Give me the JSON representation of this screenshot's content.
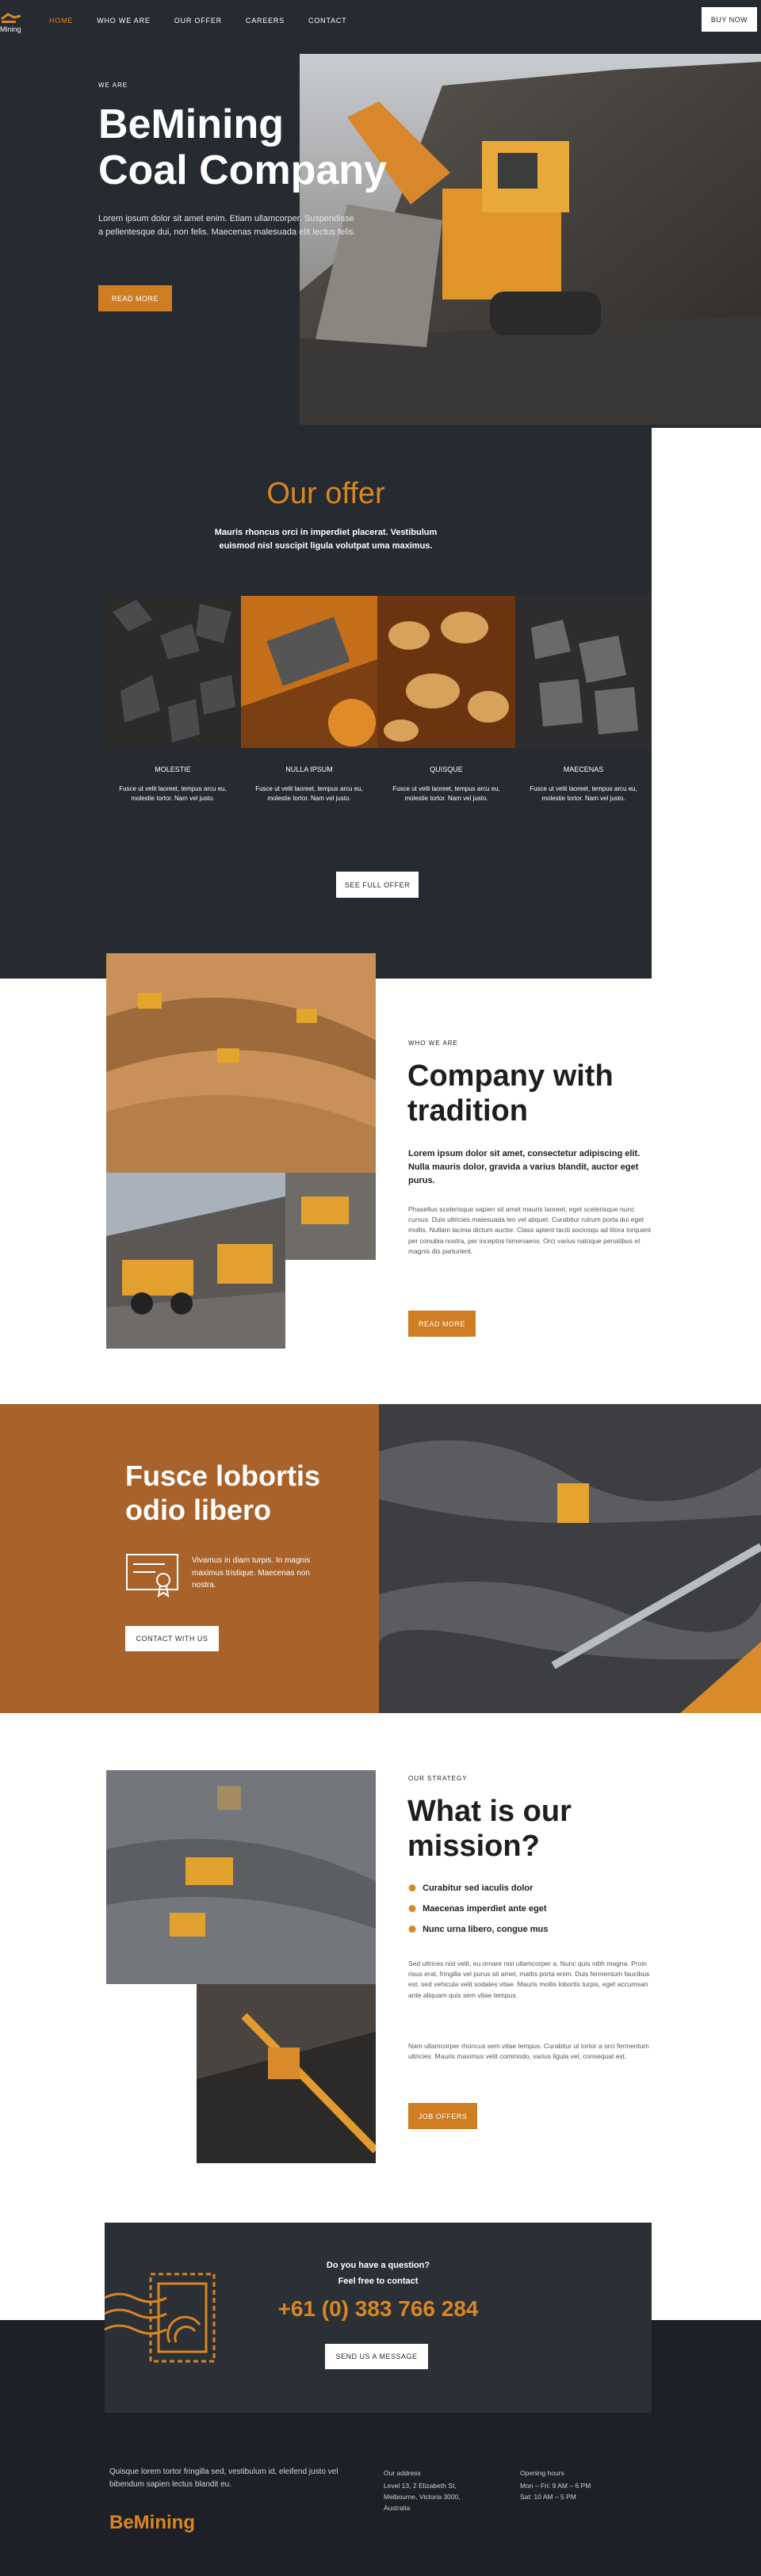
{
  "header": {
    "logo_text": "Mining",
    "nav": [
      "Home",
      "Who we are",
      "Our offer",
      "Careers",
      "Contact"
    ],
    "buy_now": "Buy now"
  },
  "hero": {
    "eyebrow": "We are",
    "title_line1": "BeMining",
    "title_line2": "Coal Company",
    "text": "Lorem ipsum dolor sit amet enim. Etiam ullamcorper. Suspendisse a pellentesque dui, non felis. Maecenas malesuada elit lectus felis.",
    "button": "Read more"
  },
  "offer": {
    "title": "Our offer",
    "subtitle": "Mauris rhoncus orci in imperdiet placerat. Vestibulum euismod nisl suscipit ligula volutpat uma maximus.",
    "items": [
      {
        "title": "Molestie",
        "text": "Fusce ut velit laoreet, tempus arcu eu, molestie tortor. Nam vel justo."
      },
      {
        "title": "Nulla ipsum",
        "text": "Fusce ut velit laoreet, tempus arcu eu, molestie tortor. Nam vel justo."
      },
      {
        "title": "Quisque",
        "text": "Fusce ut velit laoreet, tempus arcu eu, molestie tortor. Nam vel justo."
      },
      {
        "title": "Maecenas",
        "text": "Fusce ut velit laoreet, tempus arcu eu, molestie tortor. Nam vel justo."
      }
    ],
    "button": "See full offer"
  },
  "tradition": {
    "eyebrow": "Who we are",
    "title_line1": "Company with",
    "title_line2": "tradition",
    "lead": "Lorem ipsum dolor sit amet, consectetur adipiscing elit. Nulla mauris dolor, gravida a varius blandit, auctor eget purus.",
    "text": "Phasellus scelerisque sapien sit amet mauris laoreet, eget scelerisque nunc cursus. Duis ultricies malesuada leo vel aliquet. Curabitur rutrum porta dui eget mollis. Nullam lacinia dictum auctor. Class aptent taciti sociosqu ad litora torquent per conubia nostra, per inceptos himenaeos. Orci varius natoque penatibus et magnis dis parturient.",
    "button": "Read more"
  },
  "fusce": {
    "title_line1": "Fusce lobortis",
    "title_line2": "odio libero",
    "text": "Vivamus in diam turpis. In magnis maximus tristique. Maecenas non nostra.",
    "button": "Contact with us"
  },
  "mission": {
    "eyebrow": "Our strategy",
    "title_line1": "What is our",
    "title_line2": "mission?",
    "bullets": [
      "Curabitur sed iaculis dolor",
      "Maecenas imperdiet ante eget",
      "Nunc urna libero, congue mus"
    ],
    "text1": "Sed ultrices nisl velit, eu ornare nisl ullamcorper a. Nunc quis nibh magna. Proin risus erat, fringilla vel purus sit amet, mattis porta enim. Duis fermentum faucibus est, sed vehicula velit sodales vitae. Mauris mollis lobortis turpis, eget accumsan ante aliquam quis sem vitae tempus.",
    "text2": "Nam ullamcorper rhoncus sem vitae tempus. Curabitur ut tortor a orci fermentum ultricies. Mauris maximus velit commodo, varius ligula vel, consequat est.",
    "button": "Job offers"
  },
  "contact": {
    "line1": "Do you have a question?",
    "line2": "Feel free to contact",
    "phone": "+61 (0) 383 766 284",
    "button": "Send us a message"
  },
  "footer": {
    "about": "Quisque lorem tortor fringilla sed, vestibulum id, eleifend justo vel bibendum sapien lectus blandit eu.",
    "brand": "BeMining",
    "address_title": "Our address",
    "address": [
      "Level 13, 2 Elizabeth St,",
      "Melbourne, Victoria 3000,",
      "Australia"
    ],
    "hours_title": "Opening hours",
    "hours": [
      "Mon – Fri: 9 AM – 6 PM",
      "Sat: 10 AM – 5 PM"
    ]
  },
  "colors": {
    "accent": "#cf7d22",
    "dark": "#262a31",
    "brown": "#a8622a"
  }
}
